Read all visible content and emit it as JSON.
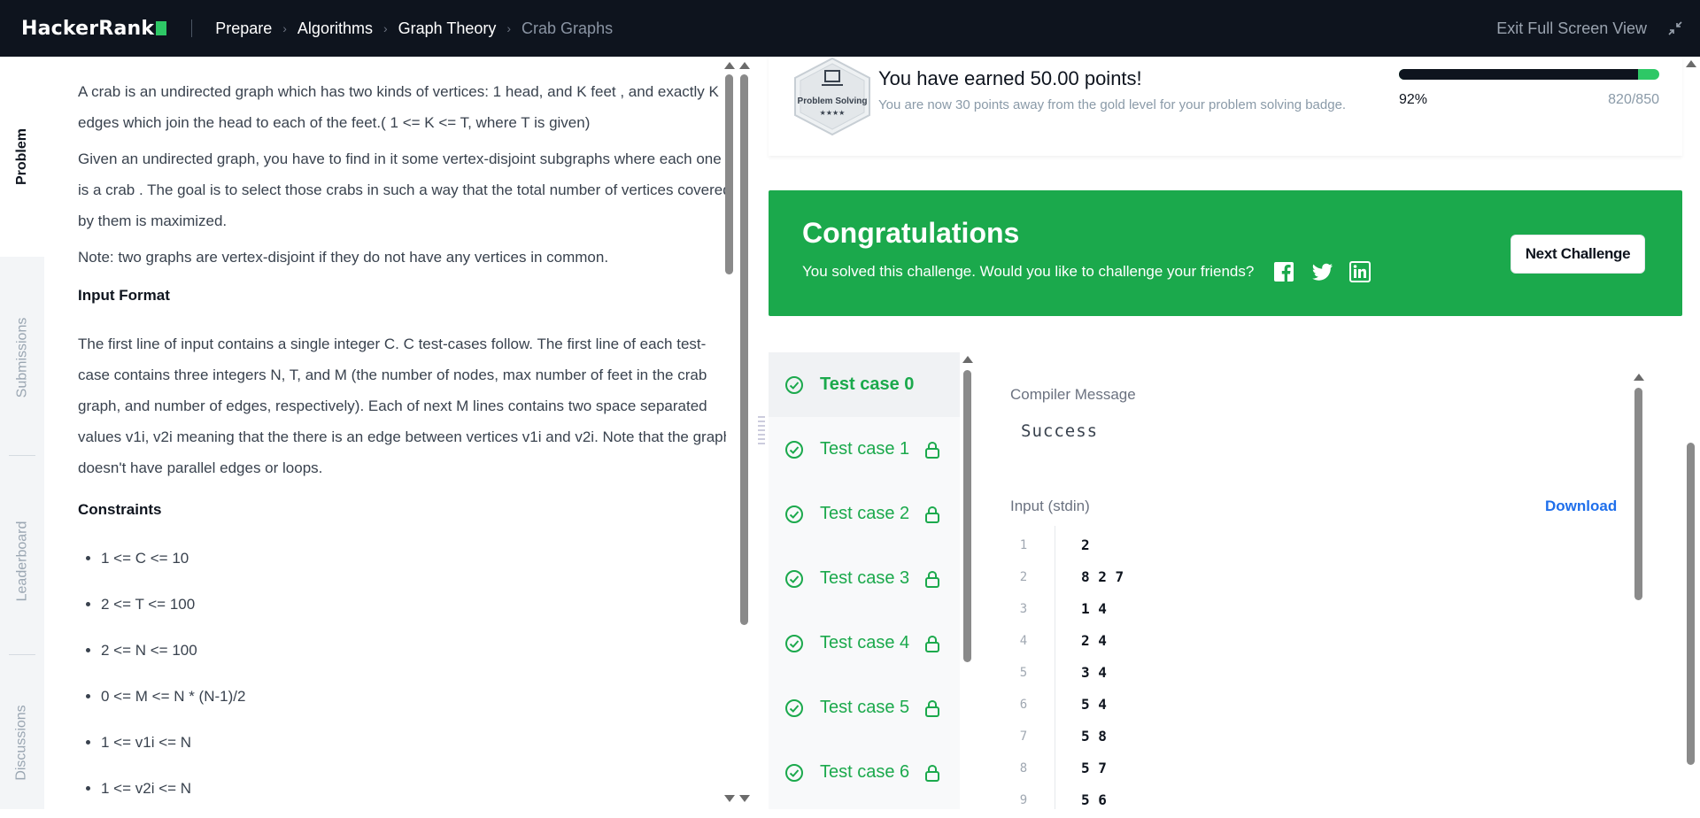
{
  "nav": {
    "brand": "HackerRank",
    "breadcrumbs": [
      "Prepare",
      "Algorithms",
      "Graph Theory",
      "Crab Graphs"
    ],
    "exit_fullscreen": "Exit Full Screen View"
  },
  "tabs": [
    "Problem",
    "Submissions",
    "Leaderboard",
    "Discussions"
  ],
  "problem": {
    "p1": "A crab is an undirected graph which has two kinds of vertices: 1 head, and K feet , and exactly K edges which join the head to each of the feet.( 1 <= K <= T, where T is given)",
    "p2": "Given an undirected graph, you have to find in it some vertex-disjoint subgraphs where each one is a crab . The goal is to select those crabs in such a way that the total number of vertices covered by them is maximized.",
    "p3": "Note: two graphs are vertex-disjoint if they do not have any vertices in common.",
    "input_heading": "Input Format",
    "input_text": "The first line of input contains a single integer C. C test-cases follow. The first line of each test-case contains three integers N, T, and M (the number of nodes, max number of feet in the crab graph, and number of edges, respectively). Each of next M lines contains two space separated values v1i, v2i meaning that the there is an edge between vertices v1i and v2i. Note that the graph doesn't have parallel edges or loops.",
    "constraints_heading": "Constraints",
    "constraints": [
      "1 <= C <= 10",
      "2 <= T <= 100",
      "2 <= N <= 100",
      "0 <= M <= N * (N-1)/2",
      "1 <= v1i <= N",
      "1 <= v2i <= N"
    ]
  },
  "badge": {
    "icon_label": "Problem Solving",
    "stars": "★★★★",
    "title": "You have earned 50.00 points!",
    "subtitle": "You are now 30 points away from the gold level for your problem solving badge.",
    "progress_fraction": 0.92,
    "percent": "92%",
    "points": "820/850"
  },
  "congrats": {
    "title": "Congratulations",
    "message": "You solved this challenge. Would you like to challenge your friends?",
    "next_button": "Next Challenge"
  },
  "testcases": [
    "Test case 0",
    "Test case 1",
    "Test case 2",
    "Test case 3",
    "Test case 4",
    "Test case 5",
    "Test case 6"
  ],
  "output": {
    "compiler_label": "Compiler Message",
    "compiler_value": "Success",
    "input_label": "Input (stdin)",
    "download": "Download",
    "line_numbers": [
      "1",
      "2",
      "3",
      "4",
      "5",
      "6",
      "7",
      "8",
      "9"
    ],
    "lines": [
      "2",
      "8 2 7",
      "1 4",
      "2 4",
      "3 4",
      "5 4",
      "5 8",
      "5 7",
      "5 6"
    ]
  },
  "colors": {
    "accent": "#1ba94c",
    "nav_bg": "#0e141e",
    "link": "#1f6feb"
  }
}
